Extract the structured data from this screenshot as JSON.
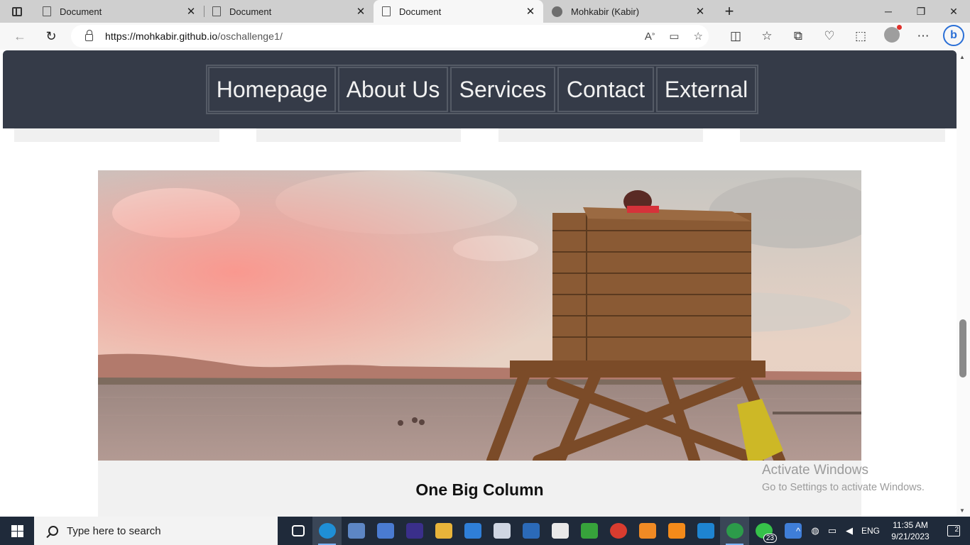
{
  "browser": {
    "tabs": [
      {
        "title": "Document",
        "icon": "page-icon"
      },
      {
        "title": "Document",
        "icon": "page-icon"
      },
      {
        "title": "Document",
        "icon": "page-icon",
        "active": true
      },
      {
        "title": "Mohkabir (Kabir)",
        "icon": "github-icon"
      }
    ],
    "new_tab": "+",
    "close": "✕",
    "url_host": "https://mohkabir.github.io",
    "url_path": "/oschallenge1/",
    "window": {
      "minimize": "─",
      "restore": "❐",
      "close": "✕"
    }
  },
  "site": {
    "menu": [
      "Homepage",
      "About Us",
      "Services",
      "Contact",
      "External"
    ],
    "hero_alt": "Lifeguard chair on a lake beach",
    "column_title": "One Big Column"
  },
  "watermark": {
    "line1": "Activate Windows",
    "line2": "Go to Settings to activate Windows."
  },
  "taskbar": {
    "search_placeholder": "Type here to search",
    "whatsapp_badge": "23",
    "language": "ENG",
    "time": "11:35 AM",
    "date": "9/21/2023",
    "notifications": "2"
  }
}
